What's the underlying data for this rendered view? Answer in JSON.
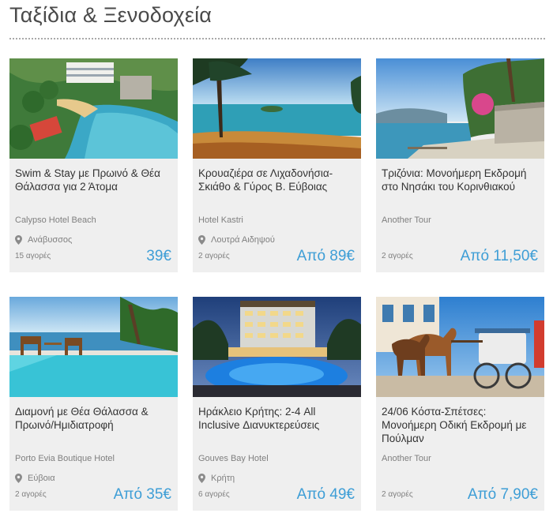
{
  "page": {
    "title": "Ταξίδια & Ξενοδοχεία"
  },
  "colors": {
    "accent": "#3e9ed6",
    "card_bg": "#efefef",
    "text": "#333333",
    "muted": "#7f7f7f"
  },
  "icons": {
    "location": "map-pin-icon"
  },
  "deals": [
    {
      "title": "Swim & Stay με Πρωινό & Θέα Θάλασσα για 2 Άτομα",
      "vendor": "Calypso Hotel Beach",
      "location": "Ανάβυσσος",
      "sold": "15 αγορές",
      "price": "39€"
    },
    {
      "title": "Κρουαζιέρα σε Λιχαδονήσια-Σκιάθο & Γύρος Β. Εύβοιας",
      "vendor": "Hotel Kastri",
      "location": "Λουτρά Αιδηψού",
      "sold": "2 αγορές",
      "price": "Από 89€"
    },
    {
      "title": "Τριζόνια: Μονοήμερη Εκδρομή στο Νησάκι του Κορινθιακού",
      "vendor": "Another Tour",
      "location": "",
      "sold": "2 αγορές",
      "price": "Από 11,50€"
    },
    {
      "title": "Διαμονή με Θέα Θάλασσα & Πρωινό/Ημιδιατροφή",
      "vendor": "Porto Evia Boutique Hotel",
      "location": "Εύβοια",
      "sold": "2 αγορές",
      "price": "Από 35€"
    },
    {
      "title": "Ηράκλειο Κρήτης: 2-4 All Inclusive Διανυκτερεύσεις",
      "vendor": "Gouves Bay Hotel",
      "location": "Κρήτη",
      "sold": "6 αγορές",
      "price": "Από 49€"
    },
    {
      "title": "24/06 Κόστα-Σπέτσες: Μονοήμερη Οδική Εκδρομή με Πούλμαν",
      "vendor": "Another Tour",
      "location": "",
      "sold": "2 αγορές",
      "price": "Από 7,90€"
    }
  ]
}
